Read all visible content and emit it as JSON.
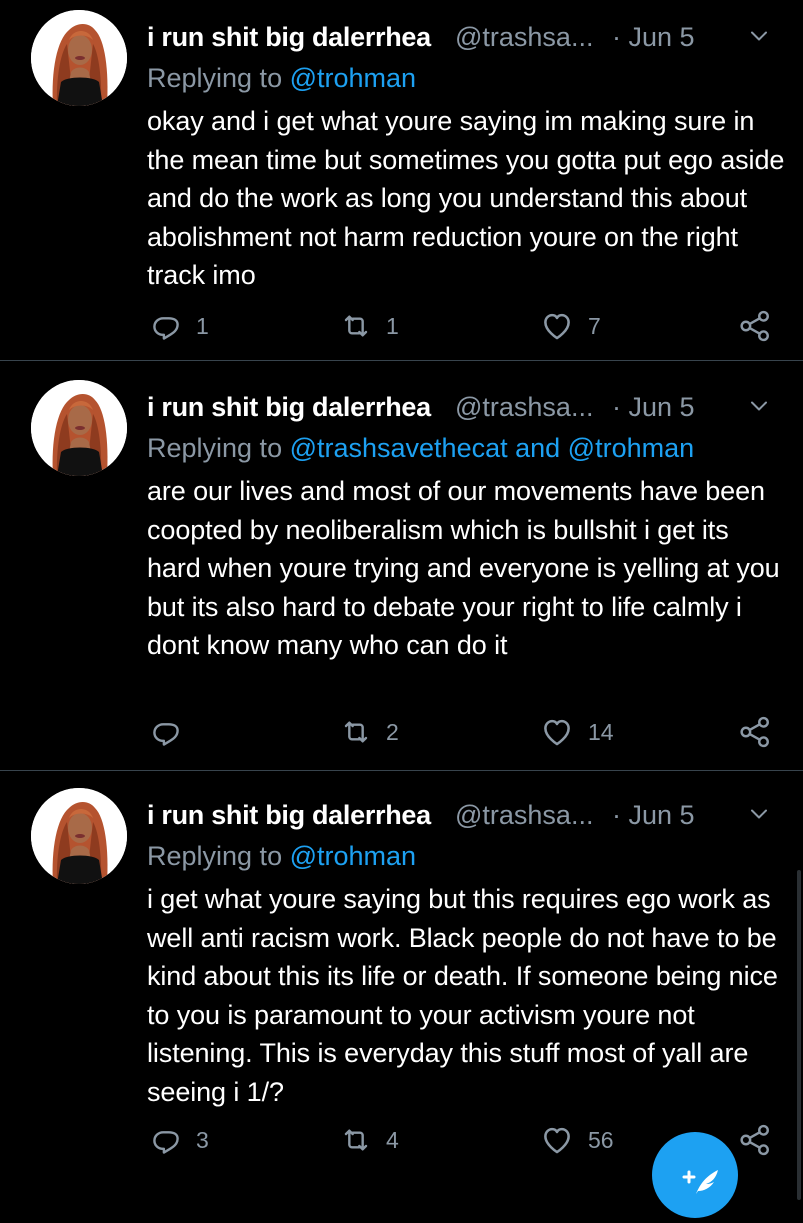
{
  "tweets": [
    {
      "name": "i run shit big dalerrhea",
      "handle": "@trashsa...",
      "date": "· Jun 5",
      "replying_prefix": "Replying to ",
      "replying_to": "@trohman",
      "text": "okay and i get what youre saying im making sure in the mean time but sometimes you gotta put ego aside and do the work as long you understand this about abolishment not harm reduction youre on the right track imo",
      "replies": "1",
      "retweets": "1",
      "likes": "7"
    },
    {
      "name": "i run shit big dalerrhea",
      "handle": "@trashsa...",
      "date": "· Jun 5",
      "replying_prefix": "Replying to ",
      "replying_to": "@trashsavethecat and @trohman",
      "text": "are our lives and most of our movements have been coopted by neoliberalism which is bullshit i get its hard when youre trying and everyone is yelling at you but its also hard to debate your right to life calmly i dont know many who can do it",
      "replies": "",
      "retweets": "2",
      "likes": "14"
    },
    {
      "name": "i run shit big dalerrhea",
      "handle": "@trashsa...",
      "date": "· Jun 5",
      "replying_prefix": "Replying to ",
      "replying_to": "@trohman",
      "text": "i get what youre saying but this requires ego work as well anti racism work. Black people do not have to be kind about this its life or death. If someone being nice to you is paramount to your activism youre not listening. This is everyday this stuff most of yall are seeing i 1/?",
      "replies": "3",
      "retweets": "4",
      "likes": "56"
    }
  ],
  "icons": {
    "reply": "reply-icon",
    "retweet": "retweet-icon",
    "like": "heart-icon",
    "share": "share-icon",
    "caret": "chevron-down-icon",
    "compose": "compose-tweet-icon"
  },
  "colors": {
    "background": "#000000",
    "text": "#ffffff",
    "secondary": "#8b98a5",
    "accent": "#1da1f2",
    "divider": "#38444d"
  }
}
